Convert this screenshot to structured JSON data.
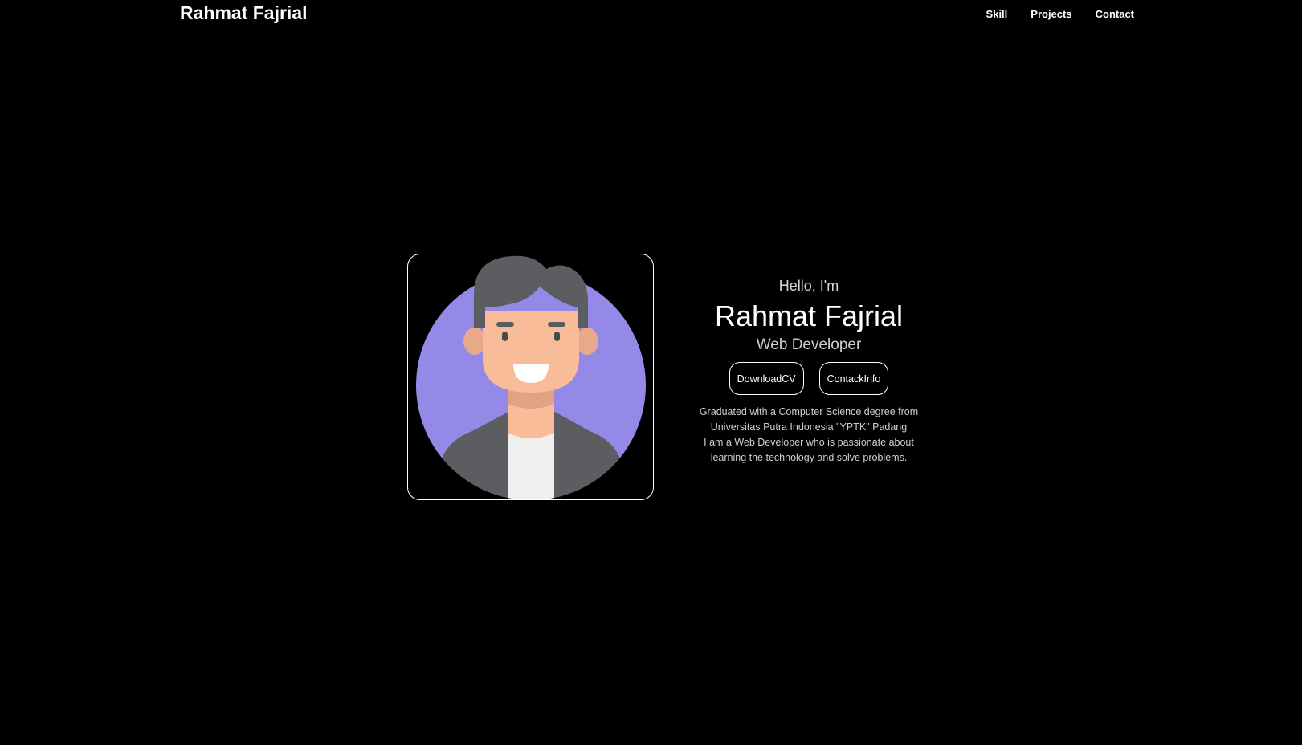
{
  "nav": {
    "brand": "Rahmat Fajrial",
    "links": [
      "Skill",
      "Projects",
      "Contact"
    ]
  },
  "hero": {
    "avatar_icon": "developer-avatar-illustration",
    "greeting": "Hello, I'm",
    "name": "Rahmat Fajrial",
    "role": "Web Developer",
    "buttons": {
      "download_cv": "DownloadCV",
      "contact_info": "ContackInfo"
    },
    "about_lines": [
      "Graduated with a Computer Science degree from",
      "Universitas Putra Indonesia \"YPTK\" Padang",
      "I am a Web Developer who is passionate about",
      "learning the technology and solve problems."
    ]
  },
  "colors": {
    "background": "#000000",
    "avatar_circle": "#9489e6",
    "hair": "#5c5d60",
    "skin": "#f9bc98",
    "jacket": "#5c5d60",
    "shirt": "#efefef"
  }
}
